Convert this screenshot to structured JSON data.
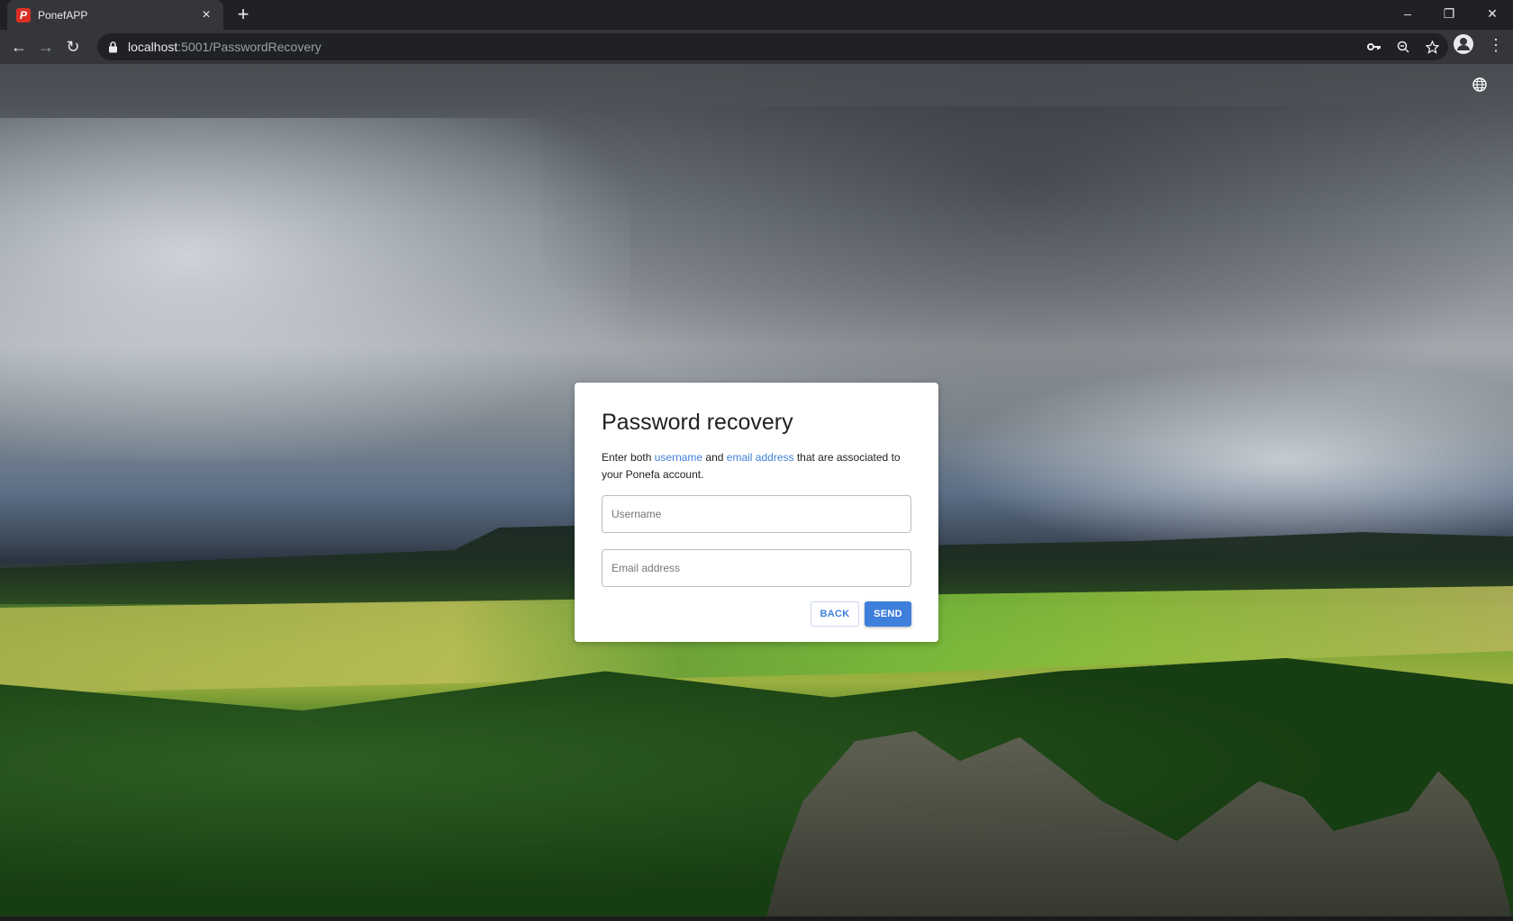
{
  "browser": {
    "tab": {
      "title": "PonefAPP",
      "favicon_letter": "P",
      "close_glyph": "×"
    },
    "new_tab_glyph": "+",
    "window_controls": {
      "minimize": "–",
      "restore": "❐",
      "close": "✕"
    },
    "nav": {
      "back": "←",
      "forward": "→",
      "reload": "↻"
    },
    "url": {
      "host": "localhost",
      "path": ":5001/PasswordRecovery"
    },
    "omnibox_icons": [
      "key-icon",
      "zoom-icon",
      "star-icon"
    ],
    "menu_glyph": "⋮"
  },
  "page": {
    "topbar": {
      "icon": "globe-icon"
    }
  },
  "card": {
    "title": "Password recovery",
    "desc_part1": "Enter both ",
    "desc_hl1": "username",
    "desc_part2": " and ",
    "desc_hl2": "email address",
    "desc_part3": " that are associated to your Ponefa account.",
    "username_placeholder": "Username",
    "email_placeholder": "Email address",
    "back_label": "BACK",
    "send_label": "SEND"
  },
  "colors": {
    "accent": "#3f7fdc",
    "browser_dark": "#202124",
    "browser_toolbar": "#35363a",
    "favicon": "#d93025"
  }
}
